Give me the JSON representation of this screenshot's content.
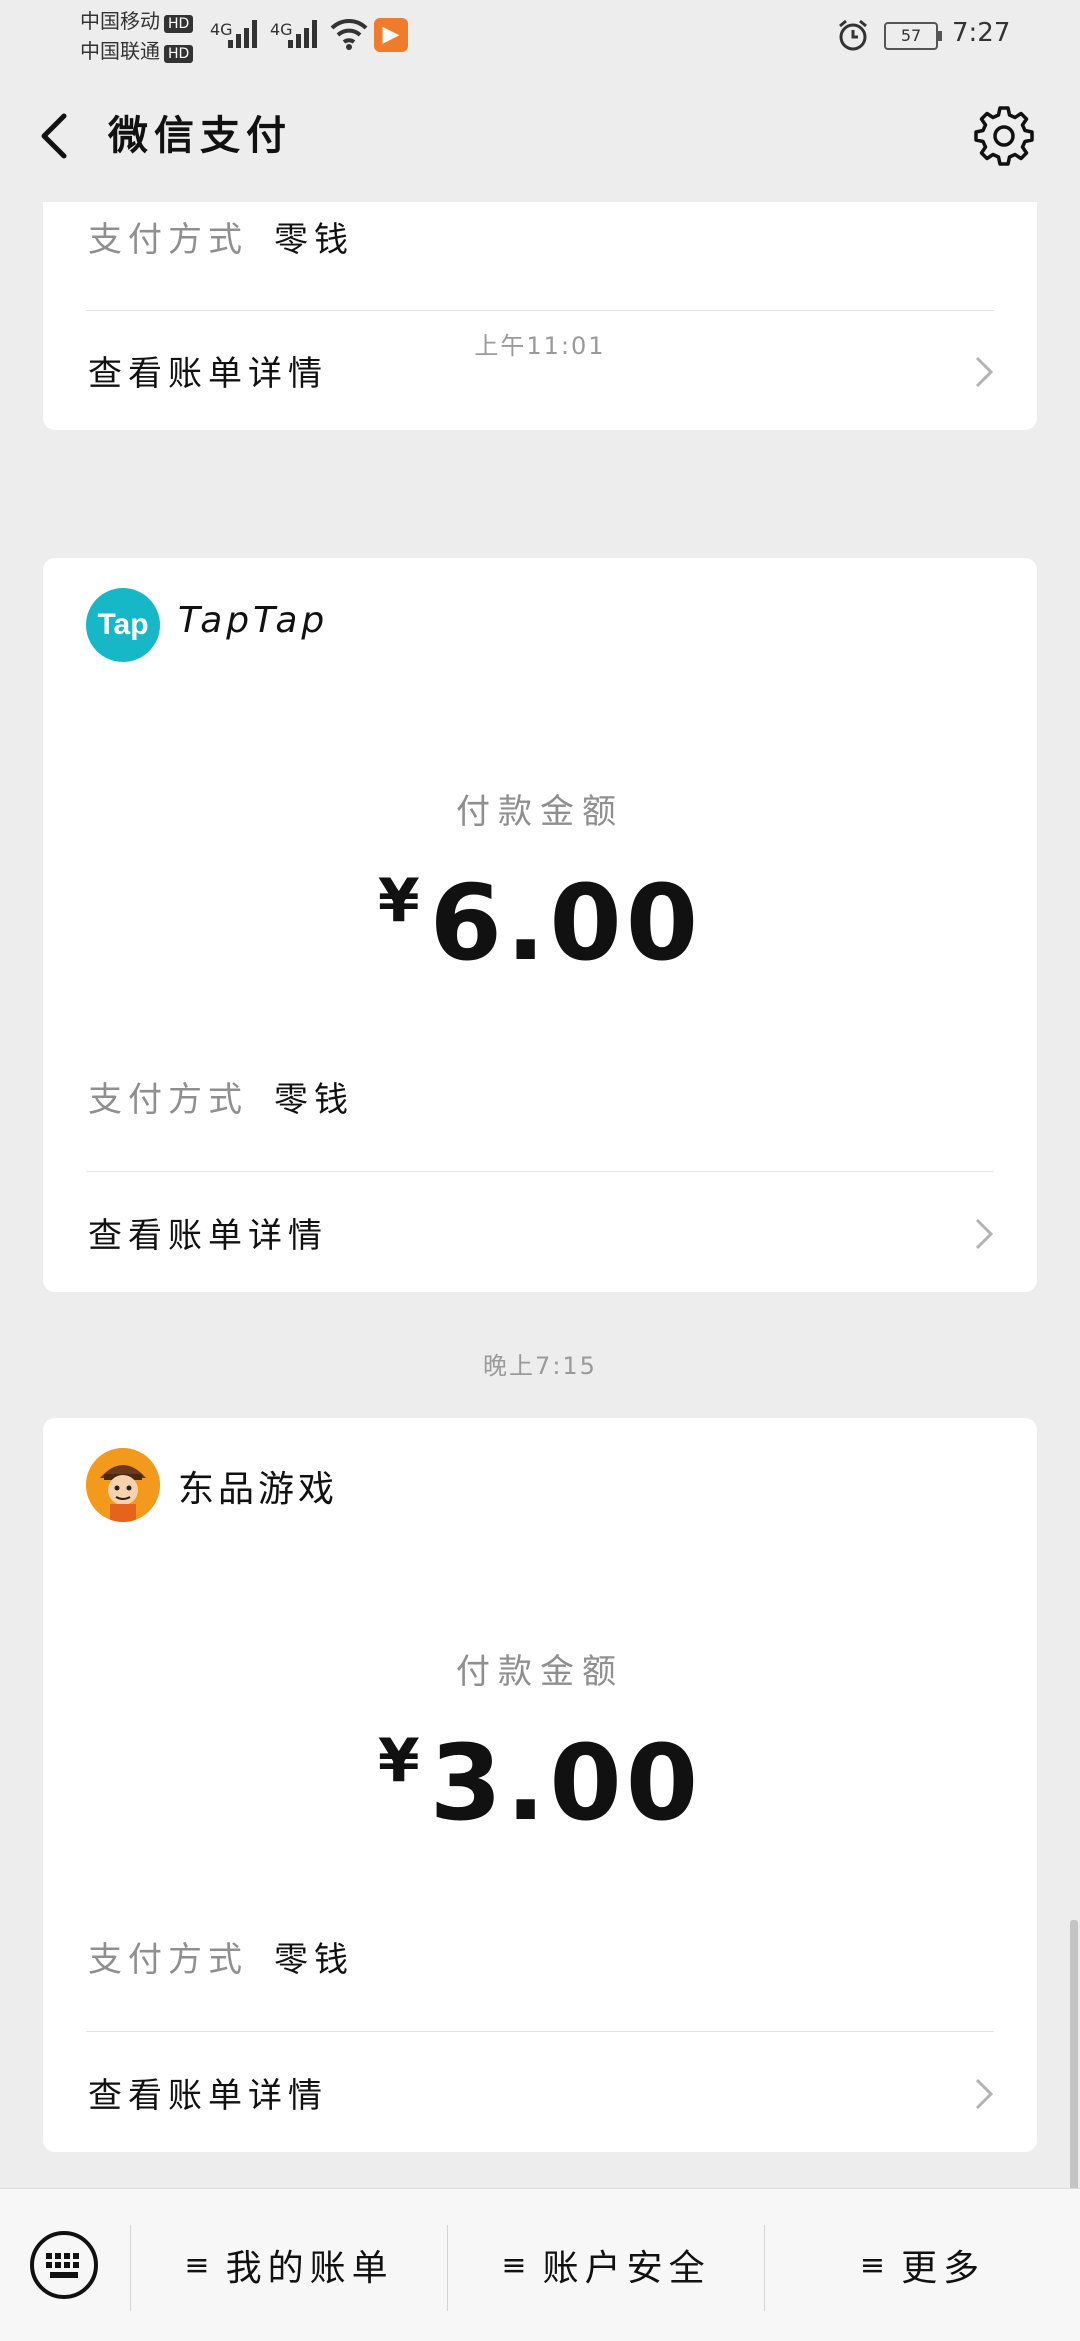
{
  "status_bar": {
    "carrier1": "中国移动",
    "carrier2": "中国联通",
    "hd": "HD",
    "network": "4G",
    "battery": "57",
    "time": "7:27"
  },
  "header": {
    "title": "微信支付"
  },
  "cards": [
    {
      "pay_method_label": "支付方式",
      "pay_method_value": "零钱",
      "detail_label": "查看账单详情"
    },
    {
      "timestamp": "上午11:01",
      "merchant": "TapTap",
      "logo_text": "Tap",
      "amount_label": "付款金额",
      "currency": "¥",
      "amount": "6.00",
      "pay_method_label": "支付方式",
      "pay_method_value": "零钱",
      "detail_label": "查看账单详情"
    },
    {
      "timestamp": "晚上7:15",
      "merchant": "东品游戏",
      "amount_label": "付款金额",
      "currency": "¥",
      "amount": "3.00",
      "pay_method_label": "支付方式",
      "pay_method_value": "零钱",
      "detail_label": "查看账单详情"
    }
  ],
  "bottom_menu": {
    "item1": "我的账单",
    "item2": "账户安全",
    "item3": "更多",
    "hamburger": "≡"
  }
}
